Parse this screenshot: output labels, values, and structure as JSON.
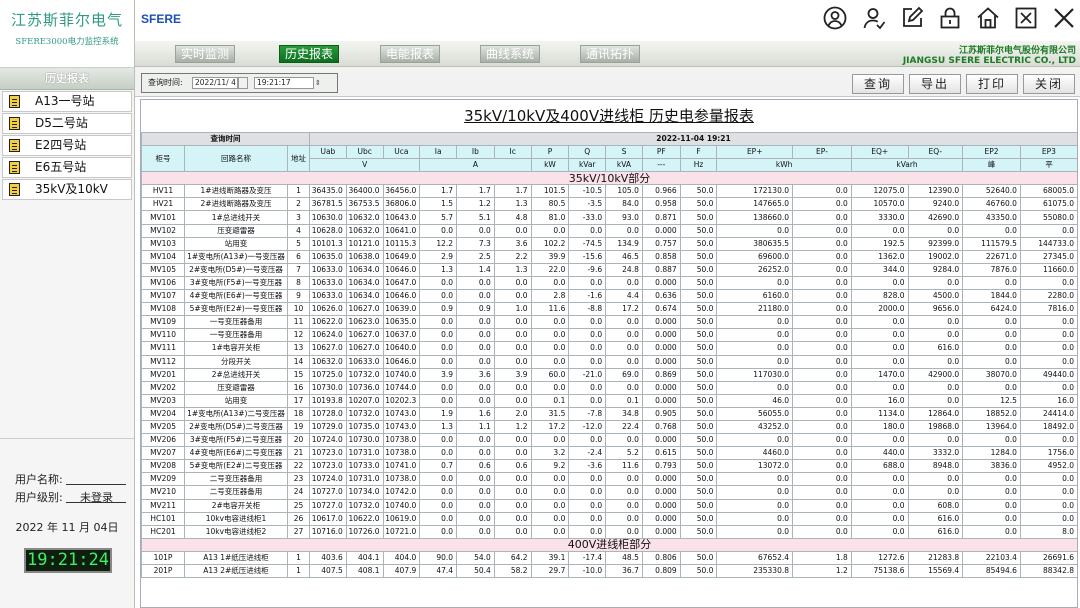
{
  "brand": {
    "title_cn": "江苏斯菲尔电气",
    "subtitle": "SFERE3000电力监控系统",
    "logo": "SFERE"
  },
  "company": {
    "name_cn": "江苏斯菲尔电气股份有限公司",
    "name_en": "JIANGSU SFERE ELECTRIC CO., LTD"
  },
  "sidebar": {
    "header": "历史报表",
    "stations": [
      {
        "label": "A13一号站"
      },
      {
        "label": "D5二号站"
      },
      {
        "label": "E2四号站"
      },
      {
        "label": "E6五号站"
      },
      {
        "label": "35kV及10kV"
      }
    ],
    "user_name_label": "用户名称:",
    "user_level_label": "用户级别:",
    "user_level_value": "未登录",
    "date": "2022 年 11 月 04日",
    "clock": "19:21:24"
  },
  "nav": {
    "tabs": [
      "实时监测",
      "历史报表",
      "电能报表",
      "曲线系统",
      "通讯拓扑"
    ],
    "active_index": 1
  },
  "toolbar": {
    "query_time_label": "查询时间:",
    "date_value": "2022/11/ 4",
    "time_value": "19:21:17",
    "buttons": [
      "查询",
      "导出",
      "打印",
      "关闭"
    ]
  },
  "report": {
    "title": "35kV/10kV及400V进线柜 历史电参量报表",
    "query_time_header": "查询时间",
    "query_time_value": "2022-11-04 19:21",
    "col_headers": [
      "柜号",
      "回路名称",
      "地址",
      "Uab",
      "Ubc",
      "Uca",
      "Ia",
      "Ib",
      "Ic",
      "P",
      "Q",
      "S",
      "PF",
      "F",
      "EP+",
      "EP-",
      "EQ+",
      "EQ-",
      "EP2",
      "EP3"
    ],
    "units": {
      "v": "V",
      "a": "A",
      "p": "kW",
      "q": "kVar",
      "s": "kVA",
      "pf": "---",
      "f": "Hz",
      "kwh": "kWh",
      "kvarh": "kVarh",
      "ep2": "峰",
      "ep3": "平"
    },
    "section1": "35kV/10kV部分",
    "section2": "400V进线柜部分",
    "rows1": [
      [
        "HV11",
        "1#进线断路器及变压",
        "1",
        "36435.0",
        "36400.0",
        "36456.0",
        "1.7",
        "1.7",
        "1.7",
        "101.5",
        "-10.5",
        "105.0",
        "0.966",
        "50.0",
        "172130.0",
        "0.0",
        "12075.0",
        "12390.0",
        "52640.0",
        "68005.0"
      ],
      [
        "HV21",
        "2#进线断路器及变压",
        "2",
        "36781.5",
        "36753.5",
        "36806.0",
        "1.5",
        "1.2",
        "1.3",
        "80.5",
        "-3.5",
        "84.0",
        "0.958",
        "50.0",
        "147665.0",
        "0.0",
        "10570.0",
        "9240.0",
        "46760.0",
        "61075.0"
      ],
      [
        "MV101",
        "1#总进线开关",
        "3",
        "10630.0",
        "10632.0",
        "10643.0",
        "5.7",
        "5.1",
        "4.8",
        "81.0",
        "-33.0",
        "93.0",
        "0.871",
        "50.0",
        "138660.0",
        "0.0",
        "3330.0",
        "42690.0",
        "43350.0",
        "55080.0"
      ],
      [
        "MV102",
        "压变避雷器",
        "4",
        "10628.0",
        "10632.0",
        "10641.0",
        "0.0",
        "0.0",
        "0.0",
        "0.0",
        "0.0",
        "0.0",
        "0.000",
        "50.0",
        "0.0",
        "0.0",
        "0.0",
        "0.0",
        "0.0",
        "0.0"
      ],
      [
        "MV103",
        "站用变",
        "5",
        "10101.3",
        "10121.0",
        "10115.3",
        "12.2",
        "7.3",
        "3.6",
        "102.2",
        "-74.5",
        "134.9",
        "0.757",
        "50.0",
        "380635.5",
        "0.0",
        "192.5",
        "92399.0",
        "111579.5",
        "144733.0"
      ],
      [
        "MV104",
        "1#变电所(A13#)一号变压器",
        "6",
        "10635.0",
        "10638.0",
        "10649.0",
        "2.9",
        "2.5",
        "2.2",
        "39.9",
        "-15.6",
        "46.5",
        "0.858",
        "50.0",
        "69600.0",
        "0.0",
        "1362.0",
        "19002.0",
        "22671.0",
        "27345.0"
      ],
      [
        "MV105",
        "2#变电所(D5#)一号变压器",
        "7",
        "10633.0",
        "10634.0",
        "10646.0",
        "1.3",
        "1.4",
        "1.3",
        "22.0",
        "-9.6",
        "24.8",
        "0.887",
        "50.0",
        "26252.0",
        "0.0",
        "344.0",
        "9284.0",
        "7876.0",
        "11660.0"
      ],
      [
        "MV106",
        "3#变电所(F5#)一号变压器",
        "8",
        "10633.0",
        "10634.0",
        "10647.0",
        "0.0",
        "0.0",
        "0.0",
        "0.0",
        "0.0",
        "0.0",
        "0.000",
        "50.0",
        "0.0",
        "0.0",
        "0.0",
        "0.0",
        "0.0",
        "0.0"
      ],
      [
        "MV107",
        "4#变电所(E6#)一号变压器",
        "9",
        "10633.0",
        "10634.0",
        "10646.0",
        "0.0",
        "0.0",
        "0.0",
        "2.8",
        "-1.6",
        "4.4",
        "0.636",
        "50.0",
        "6160.0",
        "0.0",
        "828.0",
        "4500.0",
        "1844.0",
        "2280.0"
      ],
      [
        "MV108",
        "5#变电所(E2#)一号变压器",
        "10",
        "10626.0",
        "10627.0",
        "10639.0",
        "0.9",
        "0.9",
        "1.0",
        "11.6",
        "-8.8",
        "17.2",
        "0.674",
        "50.0",
        "21180.0",
        "0.0",
        "2000.0",
        "9656.0",
        "6424.0",
        "7816.0"
      ],
      [
        "MV109",
        "一号变压器备用",
        "11",
        "10622.0",
        "10623.0",
        "10635.0",
        "0.0",
        "0.0",
        "0.0",
        "0.0",
        "0.0",
        "0.0",
        "0.000",
        "50.0",
        "0.0",
        "0.0",
        "0.0",
        "0.0",
        "0.0",
        "0.0"
      ],
      [
        "MV110",
        "一号变压器备用",
        "12",
        "10624.0",
        "10627.0",
        "10637.0",
        "0.0",
        "0.0",
        "0.0",
        "0.0",
        "0.0",
        "0.0",
        "0.000",
        "50.0",
        "0.0",
        "0.0",
        "0.0",
        "0.0",
        "0.0",
        "0.0"
      ],
      [
        "MV111",
        "1#电容开关柜",
        "13",
        "10627.0",
        "10627.0",
        "10640.0",
        "0.0",
        "0.0",
        "0.0",
        "0.0",
        "0.0",
        "0.0",
        "0.000",
        "50.0",
        "0.0",
        "0.0",
        "0.0",
        "616.0",
        "0.0",
        "0.0"
      ],
      [
        "MV112",
        "分段开关",
        "14",
        "10632.0",
        "10633.0",
        "10646.0",
        "0.0",
        "0.0",
        "0.0",
        "0.0",
        "0.0",
        "0.0",
        "0.000",
        "50.0",
        "0.0",
        "0.0",
        "0.0",
        "0.0",
        "0.0",
        "0.0"
      ],
      [
        "MV201",
        "2#总进线开关",
        "15",
        "10725.0",
        "10732.0",
        "10740.0",
        "3.9",
        "3.6",
        "3.9",
        "60.0",
        "-21.0",
        "69.0",
        "0.869",
        "50.0",
        "117030.0",
        "0.0",
        "1470.0",
        "42900.0",
        "38070.0",
        "49440.0"
      ],
      [
        "MV202",
        "压变避雷器",
        "16",
        "10730.0",
        "10736.0",
        "10744.0",
        "0.0",
        "0.0",
        "0.0",
        "0.0",
        "0.0",
        "0.0",
        "0.000",
        "50.0",
        "0.0",
        "0.0",
        "0.0",
        "0.0",
        "0.0",
        "0.0"
      ],
      [
        "MV203",
        "站用变",
        "17",
        "10193.8",
        "10207.0",
        "10202.3",
        "0.0",
        "0.0",
        "0.0",
        "0.1",
        "0.0",
        "0.1",
        "0.000",
        "50.0",
        "46.0",
        "0.0",
        "16.0",
        "0.0",
        "12.5",
        "16.0"
      ],
      [
        "MV204",
        "1#变电所(A13#)二号变压器",
        "18",
        "10728.0",
        "10732.0",
        "10743.0",
        "1.9",
        "1.6",
        "2.0",
        "31.5",
        "-7.8",
        "34.8",
        "0.905",
        "50.0",
        "56055.0",
        "0.0",
        "1134.0",
        "12864.0",
        "18852.0",
        "24414.0"
      ],
      [
        "MV205",
        "2#变电所(D5#)二号变压器",
        "19",
        "10729.0",
        "10735.0",
        "10743.0",
        "1.3",
        "1.1",
        "1.2",
        "17.2",
        "-12.0",
        "22.4",
        "0.768",
        "50.0",
        "43252.0",
        "0.0",
        "180.0",
        "19868.0",
        "13964.0",
        "18492.0"
      ],
      [
        "MV206",
        "3#变电所(F5#)二号变压器",
        "20",
        "10724.0",
        "10730.0",
        "10738.0",
        "0.0",
        "0.0",
        "0.0",
        "0.0",
        "0.0",
        "0.0",
        "0.000",
        "50.0",
        "0.0",
        "0.0",
        "0.0",
        "0.0",
        "0.0",
        "0.0"
      ],
      [
        "MV207",
        "4#变电所(E6#)二号变压器",
        "21",
        "10723.0",
        "10731.0",
        "10738.0",
        "0.0",
        "0.0",
        "0.0",
        "3.2",
        "-2.4",
        "5.2",
        "0.615",
        "50.0",
        "4460.0",
        "0.0",
        "440.0",
        "3332.0",
        "1284.0",
        "1756.0"
      ],
      [
        "MV208",
        "5#变电所(E2#)二号变压器",
        "22",
        "10723.0",
        "10733.0",
        "10741.0",
        "0.7",
        "0.6",
        "0.6",
        "9.2",
        "-3.6",
        "11.6",
        "0.793",
        "50.0",
        "13072.0",
        "0.0",
        "688.0",
        "8948.0",
        "3836.0",
        "4952.0"
      ],
      [
        "MV209",
        "二号变压器备用",
        "23",
        "10724.0",
        "10731.0",
        "10738.0",
        "0.0",
        "0.0",
        "0.0",
        "0.0",
        "0.0",
        "0.0",
        "0.000",
        "50.0",
        "0.0",
        "0.0",
        "0.0",
        "0.0",
        "0.0",
        "0.0"
      ],
      [
        "MV210",
        "二号变压器备用",
        "24",
        "10727.0",
        "10734.0",
        "10742.0",
        "0.0",
        "0.0",
        "0.0",
        "0.0",
        "0.0",
        "0.0",
        "0.000",
        "50.0",
        "0.0",
        "0.0",
        "0.0",
        "0.0",
        "0.0",
        "0.0"
      ],
      [
        "MV211",
        "2#电容开关柜",
        "25",
        "10727.0",
        "10732.0",
        "10740.0",
        "0.0",
        "0.0",
        "0.0",
        "0.0",
        "0.0",
        "0.0",
        "0.000",
        "50.0",
        "0.0",
        "0.0",
        "0.0",
        "608.0",
        "0.0",
        "0.0"
      ],
      [
        "HC101",
        "10kv电容进线柜1",
        "26",
        "10617.0",
        "10622.0",
        "10619.0",
        "0.0",
        "0.0",
        "0.0",
        "0.0",
        "0.0",
        "0.0",
        "0.000",
        "50.0",
        "0.0",
        "0.0",
        "0.0",
        "616.0",
        "0.0",
        "0.0"
      ],
      [
        "HC201",
        "10kv电容进线柜2",
        "27",
        "10716.0",
        "10726.0",
        "10721.0",
        "0.0",
        "0.0",
        "0.0",
        "0.0",
        "0.0",
        "0.0",
        "0.000",
        "50.0",
        "0.0",
        "0.0",
        "0.0",
        "616.0",
        "0.0",
        "8.0"
      ]
    ],
    "rows2": [
      [
        "101P",
        "A13 1#纸压进线柜",
        "1",
        "403.6",
        "404.1",
        "404.0",
        "90.0",
        "54.0",
        "64.2",
        "39.1",
        "-17.4",
        "48.5",
        "0.806",
        "50.0",
        "67652.4",
        "1.8",
        "1272.6",
        "21283.8",
        "22103.4",
        "26691.6"
      ],
      [
        "201P",
        "A13 2#纸压进线柜",
        "1",
        "407.5",
        "408.1",
        "407.9",
        "47.4",
        "50.4",
        "58.2",
        "29.7",
        "-10.0",
        "36.7",
        "0.809",
        "50.0",
        "235330.8",
        "1.2",
        "75138.6",
        "15569.4",
        "85494.6",
        "88342.8"
      ]
    ]
  }
}
